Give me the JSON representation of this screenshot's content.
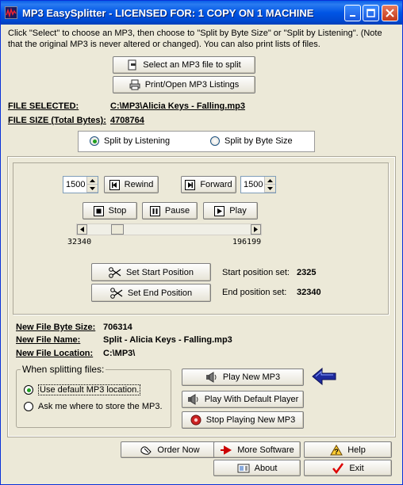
{
  "window": {
    "title": "MP3 EasySplitter - LICENSED FOR: 1 COPY ON 1 MACHINE",
    "accent_color": "#0055e5"
  },
  "intro_text": "Click \"Select\" to choose an MP3, then choose to \"Split by Byte Size\" or \"Split by Listening\". (Note that the original MP3 is never altered or changed). You can also print lists of files.",
  "top_buttons": {
    "select_label": "Select an MP3 file to split",
    "print_label": "Print/Open MP3 Listings"
  },
  "file_info": {
    "selected_label": "FILE SELECTED:",
    "selected_value": "C:\\MP3\\Alicia Keys - Falling.mp3",
    "size_label": "FILE SIZE (Total Bytes):",
    "size_value": "4708764"
  },
  "split_mode": {
    "listening_label": "Split by Listening",
    "bytesize_label": "Split by Byte Size",
    "selected": "listening"
  },
  "player": {
    "rewind_amount": "1500",
    "rewind_label": "Rewind",
    "forward_label": "Forward",
    "forward_amount": "1500",
    "stop_label": "Stop",
    "pause_label": "Pause",
    "play_label": "Play",
    "scroll_left_value": "32340",
    "scroll_right_value": "196199",
    "scroll_position_fraction": 0.16
  },
  "positions": {
    "set_start_label": "Set Start Position",
    "set_end_label": "Set End Position",
    "start_label": "Start position set:",
    "start_value": "2325",
    "end_label": "End position set:",
    "end_value": "32340"
  },
  "new_file": {
    "size_label": "New File Byte Size:",
    "size_value": "706314",
    "name_label": "New File Name:",
    "name_value": "Split - Alicia Keys - Falling.mp3",
    "location_label": "New File Location:",
    "location_value": "C:\\MP3\\"
  },
  "splitting_options": {
    "title": "When splitting files:",
    "default_label": "Use default MP3 location.",
    "ask_label": "Ask me where to store the MP3.",
    "selected": "default"
  },
  "playback_buttons": {
    "play_new_label": "Play New MP3",
    "play_default_label": "Play With Default Player",
    "stop_playing_label": "Stop Playing New MP3"
  },
  "bottom_buttons": {
    "order_label": "Order Now",
    "more_label": "More Software",
    "help_label": "Help",
    "about_label": "About",
    "exit_label": "Exit"
  },
  "icons": [
    "select-file-icon",
    "printer-icon",
    "rewind-icon",
    "forward-icon",
    "stop-icon",
    "pause-icon",
    "play-icon",
    "scissors-icon",
    "speaker-icon",
    "record-icon",
    "order-icon",
    "arrow-icon",
    "help-icon",
    "about-icon",
    "exit-check-icon",
    "blue-left-arrow-icon"
  ]
}
